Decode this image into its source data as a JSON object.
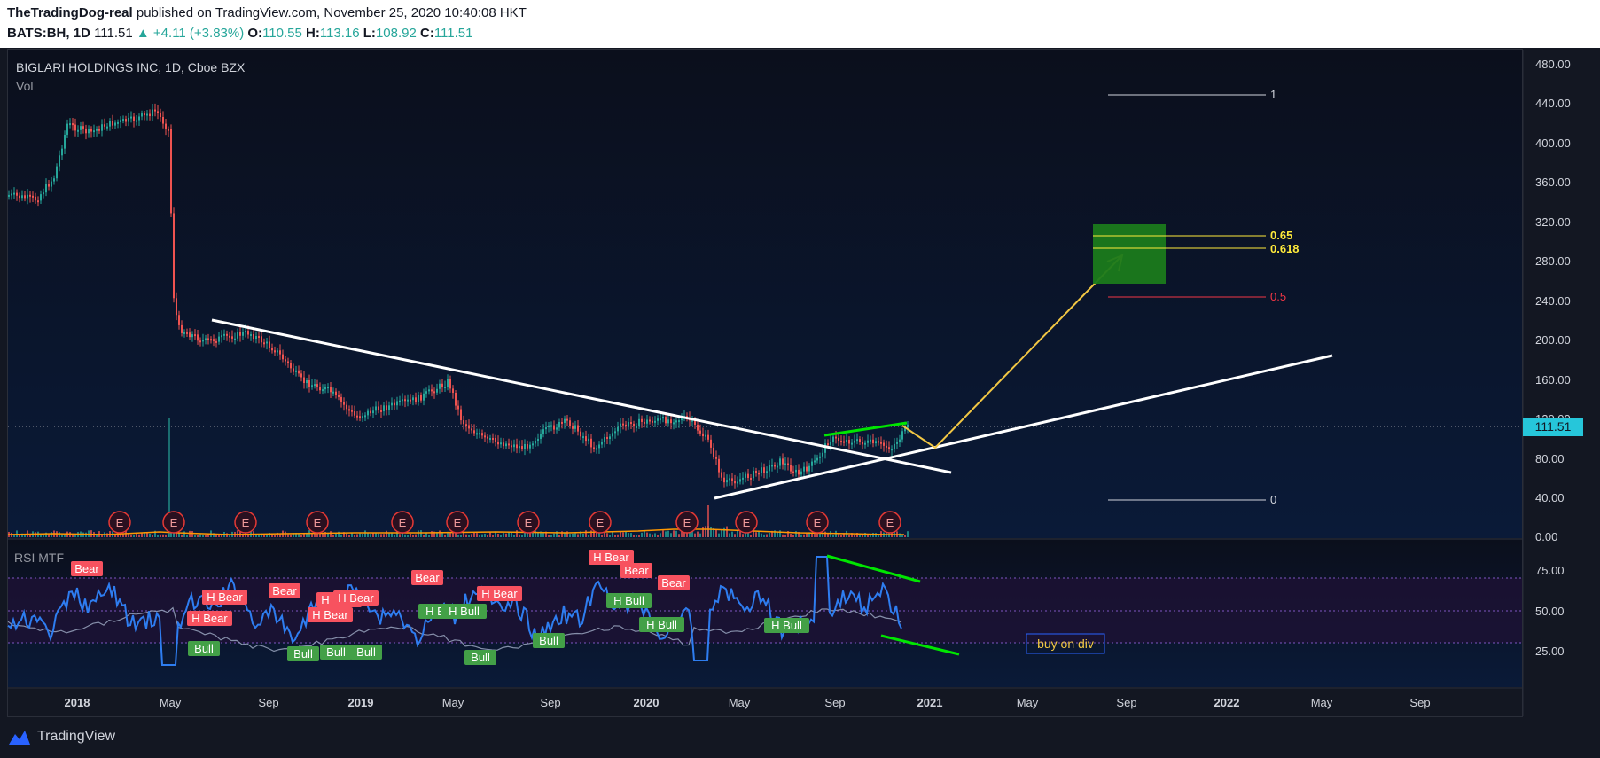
{
  "header": {
    "author": "TheTradingDog-real",
    "published_text": "published on TradingView.com, November 25, 2020 10:40:08 HKT",
    "symbol": "BATS:BH, 1D",
    "last": "111.51",
    "change": "+4.11 (+3.83%)",
    "o_label": "O:",
    "o_val": "110.55",
    "h_label": "H:",
    "h_val": "113.16",
    "l_label": "L:",
    "l_val": "108.92",
    "c_label": "C:",
    "c_val": "111.51"
  },
  "main_pane": {
    "title": "BIGLARI HOLDINGS INC, 1D, Cboe BZX",
    "vol_label": "Vol",
    "price_badge": "111.51",
    "earnings_marker": "E",
    "y_ticks": [
      "480.00",
      "440.00",
      "400.00",
      "360.00",
      "320.00",
      "280.00",
      "240.00",
      "200.00",
      "160.00",
      "120.00",
      "80.00",
      "40.00",
      "0.00"
    ]
  },
  "fib": {
    "levels": [
      {
        "label": "1",
        "color": "#d1d4dc"
      },
      {
        "label": "0.65",
        "color": "#ffeb3b"
      },
      {
        "label": "0.618",
        "color": "#ffeb3b"
      },
      {
        "label": "0.5",
        "color": "#f23645"
      },
      {
        "label": "0",
        "color": "#d1d4dc"
      }
    ]
  },
  "rsi_pane": {
    "title": "RSI MTF",
    "y_ticks": [
      "75.00",
      "50.00",
      "25.00"
    ],
    "annotation": "buy on div",
    "signals": {
      "bear": "Bear",
      "h_bear": "H Bear",
      "bull": "Bull",
      "h_bull": "H Bull"
    }
  },
  "x_axis": {
    "labels": [
      "2018",
      "May",
      "Sep",
      "2019",
      "May",
      "Sep",
      "2020",
      "May",
      "Sep",
      "2021",
      "May",
      "Sep",
      "2022",
      "May",
      "Sep"
    ]
  },
  "footer": {
    "brand": "TradingView"
  },
  "colors": {
    "background": "#131722",
    "candle_up": "#26a69a",
    "candle_down": "#ef5350",
    "rsi_line": "#2196f3",
    "trend_white": "#ffffff",
    "divergence_green": "#00e600",
    "projection_yellow": "#f2c744",
    "target_box": "#1b7a1b"
  }
}
